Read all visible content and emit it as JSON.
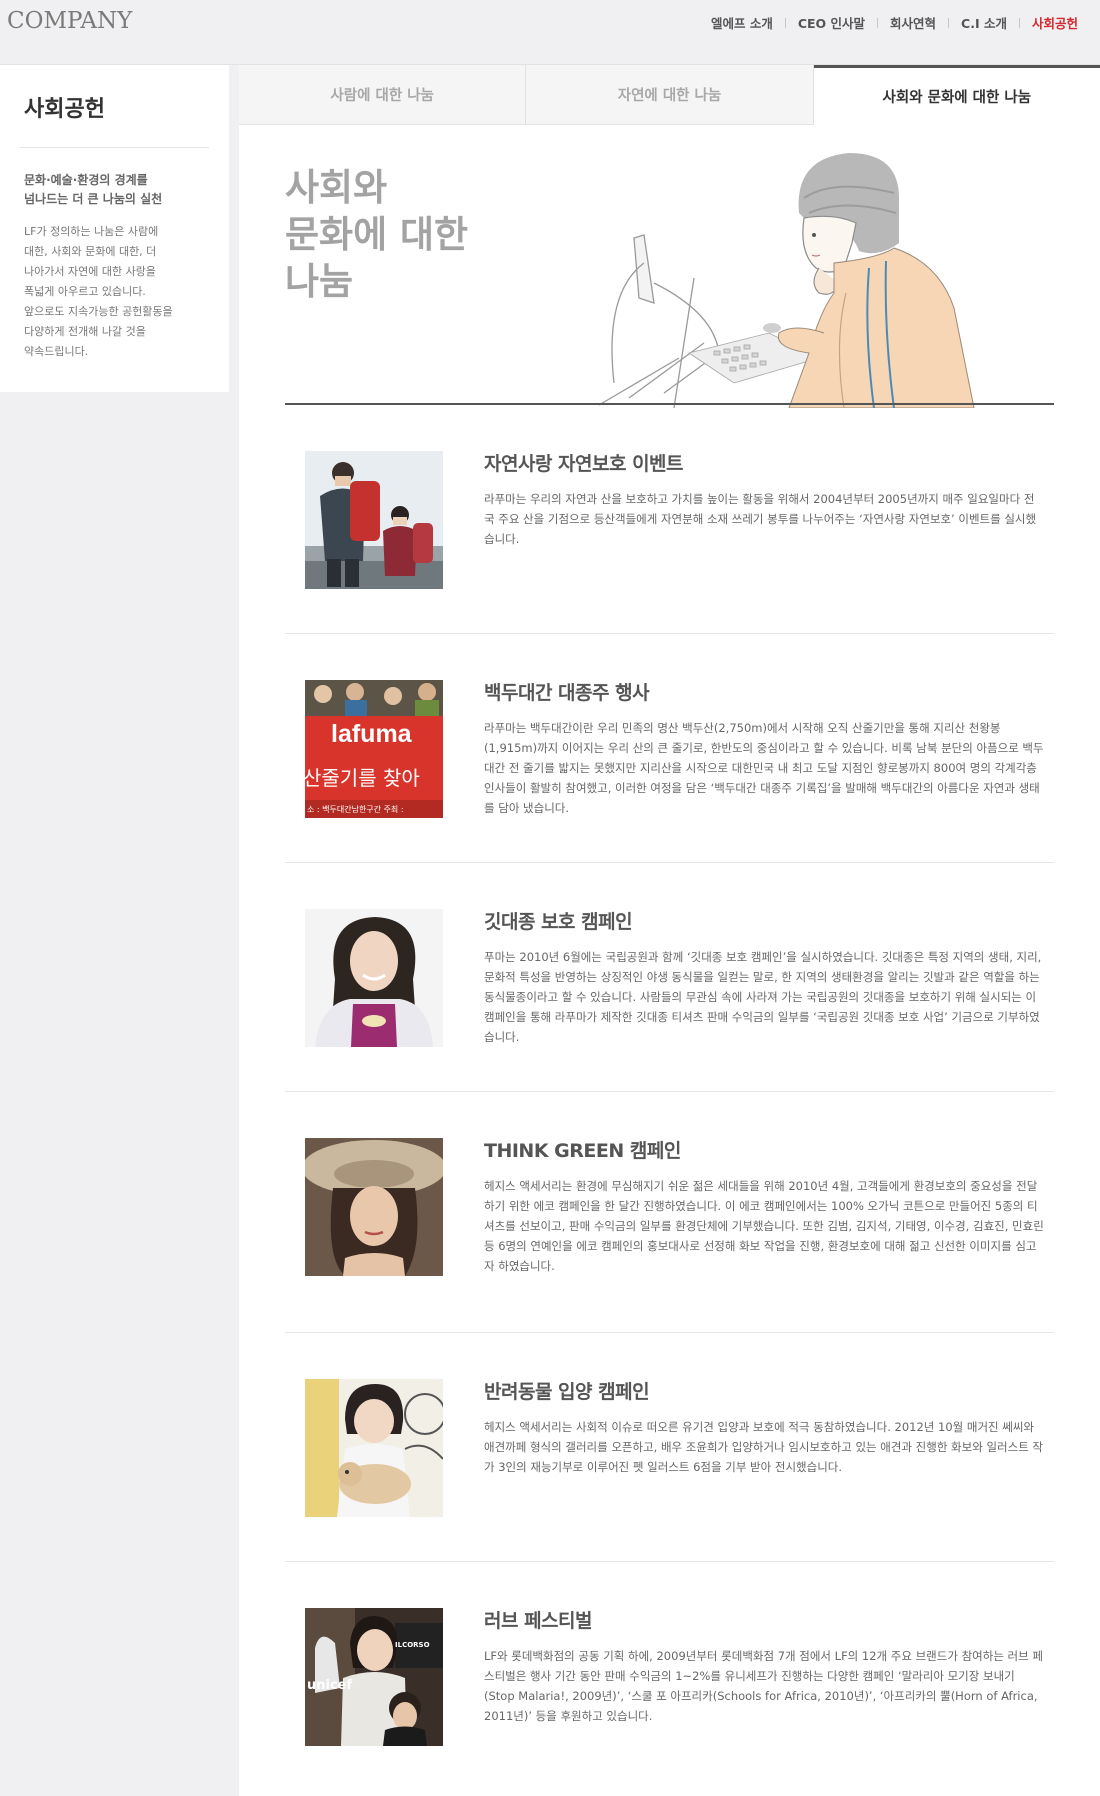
{
  "header": {
    "logo": "COMPANY",
    "nav": [
      {
        "label": "엘에프 소개"
      },
      {
        "label": "CEO 인사말"
      },
      {
        "label": "회사연혁"
      },
      {
        "label": "C.I 소개"
      },
      {
        "label": "사회공헌",
        "active": true
      }
    ],
    "active_color": "#d2282e"
  },
  "sidebar": {
    "title": "사회공헌",
    "heading": "문화·예술·환경의 경계를\n넘나드는 더 큰 나눔의 실천",
    "body": "LF가 정의하는 나눔은 사람에\n대한, 사회와 문화에 대한, 더\n나아가서 자연에 대한 사랑을\n폭넓게 아우르고 있습니다.\n앞으로도 지속가능한 공헌활동을\n다양하게 전개해 나갈 것을\n약속드립니다."
  },
  "tabs": [
    {
      "label": "사람에 대한 나눔",
      "active": false
    },
    {
      "label": "자연에 대한 나눔",
      "active": false
    },
    {
      "label": "사회와 문화에 대한 나눔",
      "active": true
    }
  ],
  "hero": {
    "title": "사회와\n문화에 대한\n나눔"
  },
  "entries": [
    {
      "title": "자연사랑 자연보호 이벤트",
      "body": "라푸마는 우리의 자연과 산을 보호하고 가치를 높이는 활동을 위해서 2004년부터 2005년까지 매주 일요일마다 전국 주요 산을 기점으로 등산객들에게 자연분해 소재 쓰레기 봉투를 나누어주는 ‘자연사랑 자연보호’ 이벤트를 실시했습니다."
    },
    {
      "title": "백두대간 대종주 행사",
      "body": "라푸마는 백두대간이란 우리 민족의 명산 백두산(2,750m)에서 시작해 오직 산줄기만을 통해 지리산 천왕봉(1,915m)까지 이어지는 우리 산의 큰 줄기로, 한반도의 중심이라고 할 수 있습니다. 비록 남북 분단의 아픔으로 백두대간 전 줄기를 밟지는 못했지만 지리산을 시작으로 대한민국 내 최고 도달 지점인 향로봉까지 800여 명의 각계각층 인사들이 활발히 참여했고, 이러한 여정을 담은 ‘백두대간 대종주 기록집’을 발매해 백두대간의 아름다운 자연과 생태를 담아 냈습니다.",
      "banner_text": "lafuma",
      "banner_sub": "산줄기를 찾아",
      "banner_caption": "소 : 백두대간남한구간   주최 :"
    },
    {
      "title": "깃대종 보호 캠페인",
      "body": "푸마는 2010년 6월에는 국립공원과 함께 ‘깃대종 보호 캠페인’을 실시하였습니다. 깃대종은 특정 지역의 생태, 지리, 문화적 특성을 반영하는 상징적인 야생 동식물을 일컫는 말로, 한 지역의 생태환경을 알리는 깃발과 같은 역할을 하는 동식물종이라고 할 수 있습니다. 사람들의 무관심 속에 사라져 가는 국립공원의 깃대종을 보호하기 위해 실시되는 이 캠페인을 통해 라푸마가 제작한 깃대종 티셔츠 판매 수익금의 일부를 ‘국립공원 깃대종 보호 사업’ 기금으로 기부하였습니다."
    },
    {
      "title": "THINK GREEN 캠페인",
      "body": "헤지스 액세서리는 환경에 무심해지기 쉬운 젊은 세대들을 위해 2010년 4월, 고객들에게 환경보호의 중요성을 전달하기 위한 에코 캠페인을 한 달간 진행하였습니다. 이 에코 캠페인에서는 100% 오가닉 코튼으로 만들어진 5종의 티셔츠를 선보이고, 판매 수익금의 일부를 환경단체에 기부했습니다. 또한 김범, 김지석, 기태영, 이수경, 김효진, 민효린 등 6명의 연예인을 에코 캠페인의 홍보대사로 선정해 화보 작업을 진행, 환경보호에 대해 젊고 신선한 이미지를 심고자 하였습니다."
    },
    {
      "title": "반려동물 입양 캠페인",
      "body": "헤지스 액세서리는 사회적 이슈로 떠오른 유기견 입양과 보호에 적극 동참하였습니다. 2012년 10월 매거진 쎄씨와 애견까페 형식의 갤러리를 오픈하고, 배우 조윤희가 입양하거나 임시보호하고 있는 애견과 진행한 화보와 일러스트 작가 3인의 재능기부로 이루어진 펫 일러스트 6점을 기부 받아 전시했습니다."
    },
    {
      "title": "러브 페스티벌",
      "body": "LF와 롯데백화점의 공동 기획 하에, 2009년부터 롯데백화점 7개 점에서 LF의 12개 주요 브랜드가 참여하는 러브 페스티벌은 행사 기간 동안 판매 수익금의 1~2%를 유니세프가 진행하는 다양한 캠페인 ‘말라리아 모기장 보내기(Stop Malaria!, 2009년)’, ‘스쿨 포 아프리카(Schools for Africa, 2010년)’, ‘아프리카의 뿔(Horn of Africa, 2011년)’ 등을 후원하고 있습니다.",
      "photo_texts": [
        "unicef",
        "ILCORSO"
      ]
    }
  ]
}
